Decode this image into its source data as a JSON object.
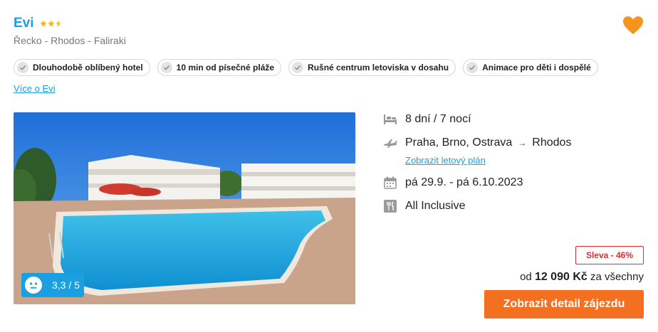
{
  "hotel": {
    "name": "Evi",
    "stars": 2.5,
    "location": "Řecko - Rhodos - Faliraki",
    "more_link": "Více o Evi"
  },
  "tags": [
    "Dlouhodobě oblíbený hotel",
    "10 min od písečné pláže",
    "Rušné centrum letoviska v dosahu",
    "Animace pro děti i dospělé"
  ],
  "rating": {
    "value": "3,3 / 5"
  },
  "details": {
    "duration": "8 dní / 7 nocí",
    "departure": "Praha, Brno, Ostrava",
    "arrow": "→",
    "destination": "Rhodos",
    "flight_plan_link": "Zobrazit letový plán",
    "dates": "pá 29.9. - pá 6.10.2023",
    "board": "All Inclusive"
  },
  "pricing": {
    "discount": "Sleva - 46%",
    "prefix": "od",
    "price": "12 090 Kč",
    "suffix": "za všechny",
    "cta": "Zobrazit detail zájezdu"
  },
  "colors": {
    "accent_blue": "#1a9fe0",
    "cta_orange": "#f37021",
    "favorite_orange": "#f7941d",
    "discount_red": "#e02b2b",
    "star_yellow": "#f5b400"
  },
  "icons": {
    "favorite": "heart-icon",
    "tag_check": "check-icon",
    "duration": "bed-icon",
    "flight": "plane-icon",
    "dates": "calendar-icon",
    "board": "cutlery-icon",
    "rating": "neutral-face-icon"
  }
}
